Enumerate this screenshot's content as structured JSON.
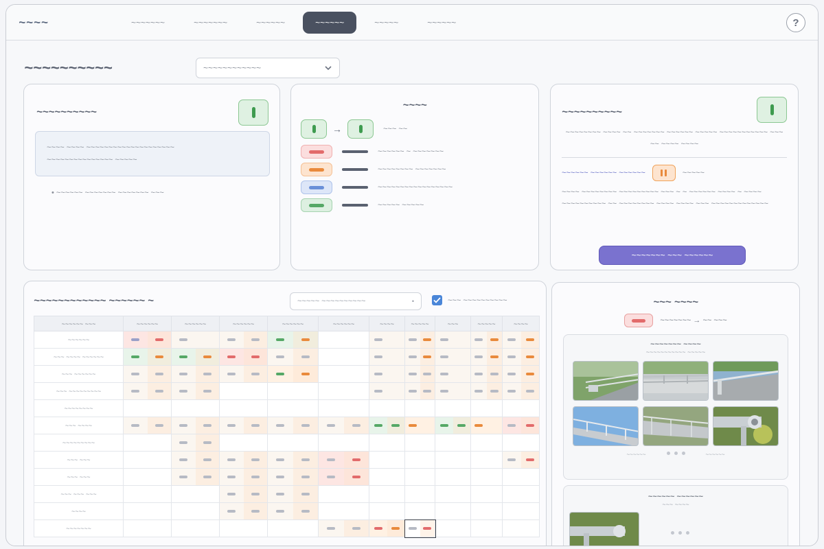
{
  "app": {
    "logo_text": "~~~~"
  },
  "nav": {
    "tabs": [
      {
        "label": "~~~~~~~"
      },
      {
        "label": "~~~~~~~"
      },
      {
        "label": "~~~~~~"
      },
      {
        "label": "~~~~~~",
        "active": true
      },
      {
        "label": "~~~~~"
      },
      {
        "label": "~~~~~~"
      }
    ],
    "help_label": "?"
  },
  "header": {
    "title": "~~~~~~~~~~",
    "select_value": "~~~~~~~~~~~~"
  },
  "panel_left": {
    "title": "~~~~~~~~~~",
    "status": "ok",
    "note_line1": "~~~~ ~~~~ ~~~~~~~~~~~~~~~~~~~~",
    "note_line2": "~~~~~~~~~~~~~~~ ~~~~~",
    "bullet": "• ~~~~~~ ~~~~~~~ ~~~~~~~ ~~~"
  },
  "panel_legend": {
    "title": "~~~~",
    "transition_label": "~~~ ~~",
    "items": [
      {
        "label": "~~~~~~ ~ ~~~~~~~",
        "color": "#e26b6b",
        "bg": "#fbdede"
      },
      {
        "label": "~~~~~~~~ ~~~~~~~",
        "color": "#e98a3c",
        "bg": "#fde4cf"
      },
      {
        "label": "~~~~~~~~~~~~~~~~~",
        "color": "#6a8fd8",
        "bg": "#dde6f8"
      },
      {
        "label": "~~~~~ ~~~~~",
        "color": "#55a866",
        "bg": "#ddf0e1"
      }
    ]
  },
  "panel_right": {
    "title": "~~~~~~~~~~",
    "status": "ok",
    "desc": "~~~~~~~~ ~~~~ ~~ ~~~~~~~ ~~~~~~ ~~~~~ ~~~~~~~~~~~ ~~~ ~~ ~~~~ ~~~~",
    "link": "~~~~~~ ~~~~~~ ~~~~~~",
    "link_tail": "~~~~~",
    "body": "~~~~ ~~~~~~~~ ~~~~~~~~~ ~~~ ~ ~ ~~~~~~ ~~~~ ~ ~~~~ ~~~~~~~~~~ ~~ ~~~~~~~~ ~~~~ ~~~~ ~~~ ~~~~~~~~~~~~~",
    "button": "~~~~~~~ ~~~ ~~~~~~"
  },
  "matrix_panel": {
    "title": "~~~~~~~~~~~~ ~~~~~~ ~",
    "filter_placeholder": "~~~~~ ~~~~~~~~~~",
    "checkbox_label": "~~~ ~~~~~~~~~~",
    "checkbox_checked": true,
    "corner_header": "~~~~~~ ~~~",
    "columns": [
      "~~~~~~",
      "~~~~~~",
      "~~~~~~",
      "~~~~~~",
      "~~~~~~",
      "~~~~",
      "~~~~~",
      "~~~",
      "~~~~~",
      "~~~~"
    ],
    "rows": [
      {
        "label": "~~~~~~"
      },
      {
        "label": "~~~ ~~~~ ~~~~~~"
      },
      {
        "label": "~~~ ~~~~~~"
      },
      {
        "label": "~~~ ~~~~~~~~~"
      },
      {
        "label": "~~~~~~~~"
      },
      {
        "label": "~~~ ~~~~"
      },
      {
        "label": "~~~~~~~~~"
      },
      {
        "label": "~~~ ~~~"
      },
      {
        "label": "~~~ ~~~"
      },
      {
        "label": "~~~ ~~~ ~~~"
      },
      {
        "label": "~~~~"
      },
      {
        "label": "~~~~~~~"
      }
    ]
  },
  "gallery_panel": {
    "title": "~~~ ~~~~",
    "tag_color": "#fbdede",
    "subtitle": "~~~~~~~ → ~~ ~~~",
    "group1_title": "~~~~~~~ ~~~~",
    "group1_sub": "~~~~~~~~~~~ ~~~~~",
    "photo_captions": [
      "~~~~~~",
      "~~~~~~",
      "~~~~~~"
    ],
    "group2_title": "~~~~~~ ~~~~~~",
    "group2_sub": "~~~ ~~~~"
  }
}
